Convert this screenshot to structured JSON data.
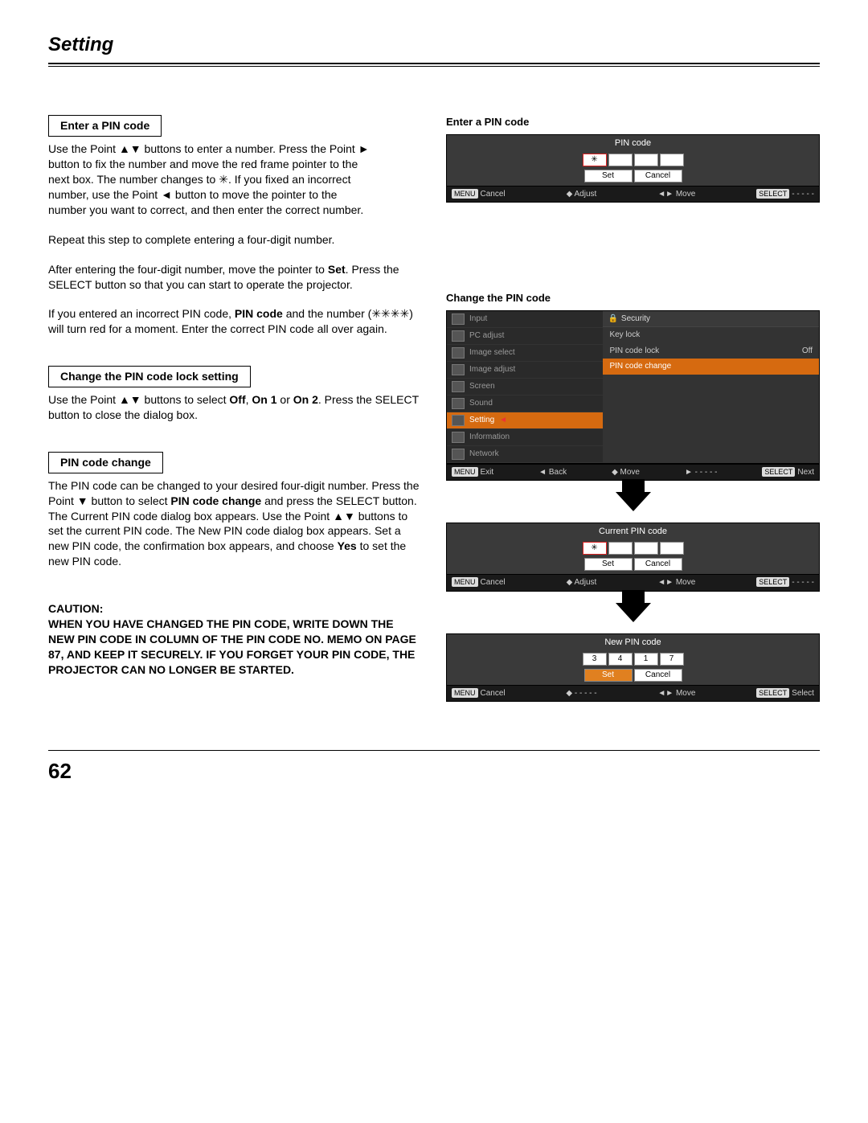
{
  "header": "Setting",
  "page_number": "62",
  "left": {
    "h1": "Enter a PIN code",
    "p1a": "Use the Point ▲▼ buttons to enter a number. Press the Point ►",
    "p1b": "button to fix the number and move the red frame pointer to the",
    "p1c": "next box. The number changes to ✳. If you fixed an incorrect",
    "p1d": "number, use the Point ◄ button to move the pointer to the",
    "p1e": "number you want to correct, and then enter the correct number.",
    "p2": "Repeat this step to complete entering a four-digit number.",
    "p3a_pre": "After entering the four-digit number, move the pointer to ",
    "p3a_bold": "Set",
    "p3a_post": ".",
    "p3b": "Press the SELECT button so that you can start to operate the projector.",
    "p4a_pre": "If you entered an incorrect PIN code, ",
    "p4a_bold": "PIN code",
    "p4a_post": " and the number (✳✳✳✳) will turn red for a moment. Enter the correct PIN code all over again.",
    "h2": "Change the PIN code lock setting",
    "p5_pre": "Use the Point ▲▼ buttons to select ",
    "p5_b1": "Off",
    "p5_m1": ", ",
    "p5_b2": "On 1",
    "p5_m2": " or ",
    "p5_b3": "On 2",
    "p5_post": ". Press the SELECT button to close the dialog box.",
    "h3": "PIN code change",
    "p6_pre": "The PIN code can be changed to your desired four-digit number. Press the Point ▼ button to select ",
    "p6_b1": "PIN code change",
    "p6_mid": " and press the SELECT button. The Current PIN code dialog box appears. Use the Point ▲▼ buttons to set the current PIN code. The New PIN code dialog box appears. Set a new PIN code, the confirmation box appears, and choose ",
    "p6_b2": "Yes",
    "p6_post": " to set the new PIN code.",
    "caution_label": "CAUTION:",
    "caution_body": "WHEN YOU HAVE CHANGED THE PIN CODE, WRITE DOWN THE NEW PIN CODE IN COLUMN OF THE PIN CODE NO. MEMO ON PAGE 87, AND KEEP IT SECURELY. IF YOU FORGET YOUR PIN CODE, THE PROJECTOR CAN NO LONGER BE STARTED."
  },
  "right": {
    "fig1_caption": "Enter a PIN code",
    "fig1": {
      "title": "PIN code",
      "cells": [
        "✳",
        "",
        "",
        ""
      ],
      "set": "Set",
      "cancel": "Cancel",
      "foot": {
        "menu": "Cancel",
        "adjust": "Adjust",
        "move": "Move",
        "select": "- - - - -"
      }
    },
    "fig2_caption": "Change the PIN code",
    "fig2": {
      "sidebar_items": [
        "Input",
        "PC adjust",
        "Image select",
        "Image adjust",
        "Screen",
        "Sound",
        "Setting",
        "Information",
        "Network"
      ],
      "sidebar_selected": "Setting",
      "panel_title": "Security",
      "opts": [
        {
          "label": "Key lock",
          "value": ""
        },
        {
          "label": "PIN code lock",
          "value": "Off"
        },
        {
          "label": "PIN code change",
          "value": ""
        }
      ],
      "highlighted": "PIN code change",
      "foot": {
        "menu": "Exit",
        "back": "Back",
        "move": "Move",
        "next": "- - - - -",
        "select": "Next"
      }
    },
    "fig3": {
      "title": "Current PIN code",
      "cells": [
        "✳",
        "",
        "",
        ""
      ],
      "set": "Set",
      "cancel": "Cancel",
      "foot": {
        "menu": "Cancel",
        "adjust": "Adjust",
        "move": "Move",
        "select": "- - - - -"
      }
    },
    "fig4": {
      "title": "New PIN code",
      "cells": [
        "3",
        "4",
        "1",
        "7"
      ],
      "set": "Set",
      "cancel": "Cancel",
      "foot": {
        "menu": "Cancel",
        "adjust": "- - - - -",
        "move": "Move",
        "select": "Select"
      }
    }
  }
}
